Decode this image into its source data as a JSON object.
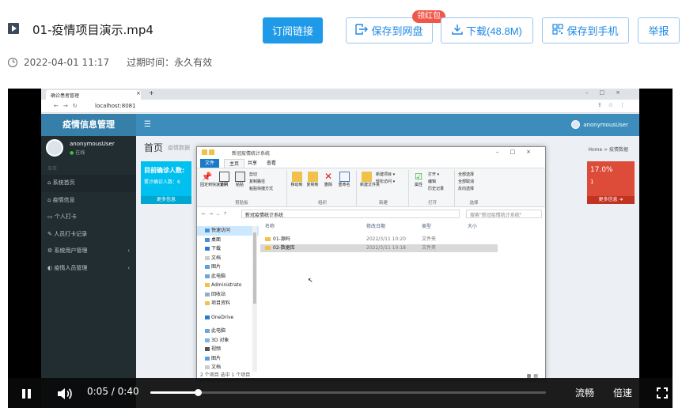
{
  "file": {
    "name": "01-疫情项目演示.mp4",
    "date": "2022-04-01 11:17",
    "expire": "过期时间：永久有效"
  },
  "actions": {
    "subscribe": "订阅链接",
    "save_cloud": "保存到网盘",
    "download": "下载(48.8M)",
    "save_phone": "保存到手机",
    "report": "举报",
    "badge": "领红包"
  },
  "browser": {
    "tab_title": "确诊患者管理",
    "url": "localhost:8081",
    "close": "×",
    "plus": "+"
  },
  "app": {
    "logo": "疫情信息管理",
    "username": "anonymousUser",
    "status": "在线",
    "section": "菜单",
    "menu": [
      "系统首页",
      "疫情信息",
      "个人打卡",
      "人员打卡记录",
      "系统用户管理",
      "疫情人员管理"
    ],
    "page_title": "首页",
    "page_sub": "疫情数据",
    "crumbs": "Home  >  疫情数据",
    "box1_title": "目前确诊人数:",
    "box1_sub": "累计确诊人数：6",
    "box1_more": "更多信息",
    "box2_title": "17.0%",
    "box2_value": "1",
    "box2_more": "更多信息 ➜"
  },
  "explorer": {
    "title": "新冠疫情统计系统",
    "tabs": [
      "文件",
      "主页",
      "共享",
      "查看"
    ],
    "ribbon": {
      "pin": "固定到快速访问",
      "copy": "复制",
      "paste": "粘贴",
      "cut": "剪切",
      "copy_path": "复制路径",
      "paste_shortcut": "粘贴快捷方式",
      "group_clipboard": "剪贴板",
      "move_to": "移动到",
      "copy_to": "复制到",
      "delete": "删除",
      "rename": "重命名",
      "group_organize": "组织",
      "new_folder": "新建文件夹",
      "new_item": "新建项目 ▾",
      "easy_access": "轻松访问 ▾",
      "group_new": "新建",
      "properties": "属性",
      "open": "打开 ▾",
      "edit": "编辑",
      "history": "历史记录",
      "group_open": "打开",
      "select_all": "全部选择",
      "select_none": "全部取消",
      "invert": "反向选择",
      "group_select": "选择"
    },
    "path": "新冠疫情统计系统",
    "search_placeholder": "搜索\"新冠疫情统计系统\"",
    "nav": [
      "快速访问",
      "桌面",
      "下载",
      "文档",
      "图片",
      "此电脑",
      "Administrato",
      "回收站",
      "项目资料",
      "OneDrive",
      "此电脑",
      "3D 对象",
      "视频",
      "图片",
      "文档"
    ],
    "columns": [
      "名称",
      "修改日期",
      "类型",
      "大小"
    ],
    "rows": [
      {
        "name": "01-源码",
        "date": "2022/3/11 10:20",
        "type": "文件夹"
      },
      {
        "name": "02-数据库",
        "date": "2022/3/11 10:18",
        "type": "文件夹"
      }
    ],
    "status": "2 个项目    选中 1 个项目"
  },
  "player": {
    "current": "0:05",
    "sep": "/",
    "total": "0:40",
    "progress": 0.12,
    "quality": "流畅",
    "speed": "倍速"
  },
  "colors": {
    "accent": "#1f9ae8",
    "badge": "#f0574b",
    "admin_blue": "#3c8dbc",
    "sidebar": "#222d32"
  }
}
